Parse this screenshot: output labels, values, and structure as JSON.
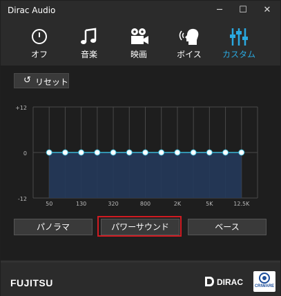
{
  "window": {
    "title": "Dirac Audio"
  },
  "tabs": [
    {
      "label": "オフ",
      "icon": "power-icon",
      "active": false
    },
    {
      "label": "音楽",
      "icon": "music-note-icon",
      "active": false
    },
    {
      "label": "映画",
      "icon": "movie-camera-icon",
      "active": false
    },
    {
      "label": "ボイス",
      "icon": "voice-icon",
      "active": false
    },
    {
      "label": "カスタム",
      "icon": "equalizer-sliders-icon",
      "active": true
    }
  ],
  "reset": {
    "label": "リセット",
    "icon": "undo-icon"
  },
  "chart_data": {
    "type": "line",
    "y_labels": [
      "+12",
      "0",
      "-12"
    ],
    "ylim": [
      -12,
      12
    ],
    "x_tick_labels": [
      "50",
      "130",
      "320",
      "800",
      "2K",
      "5K",
      "12.5K"
    ],
    "bands": 13,
    "values": [
      0,
      0,
      0,
      0,
      0,
      0,
      0,
      0,
      0,
      0,
      0,
      0,
      0
    ],
    "grid": true,
    "line_color": "#3ab7d6",
    "fill_color": "#23395a"
  },
  "presets": [
    {
      "label": "パノラマ",
      "highlighted": false
    },
    {
      "label": "パワーサウンド",
      "highlighted": true
    },
    {
      "label": "ベース",
      "highlighted": false
    }
  ],
  "footer": {
    "left_logo": "FUJITSU",
    "center_logo": "DIRAC",
    "right_logo": "CRIWARE"
  },
  "colors": {
    "accent": "#2aa9e0",
    "highlight": "#d11b22",
    "background": "#2b2b2b"
  }
}
